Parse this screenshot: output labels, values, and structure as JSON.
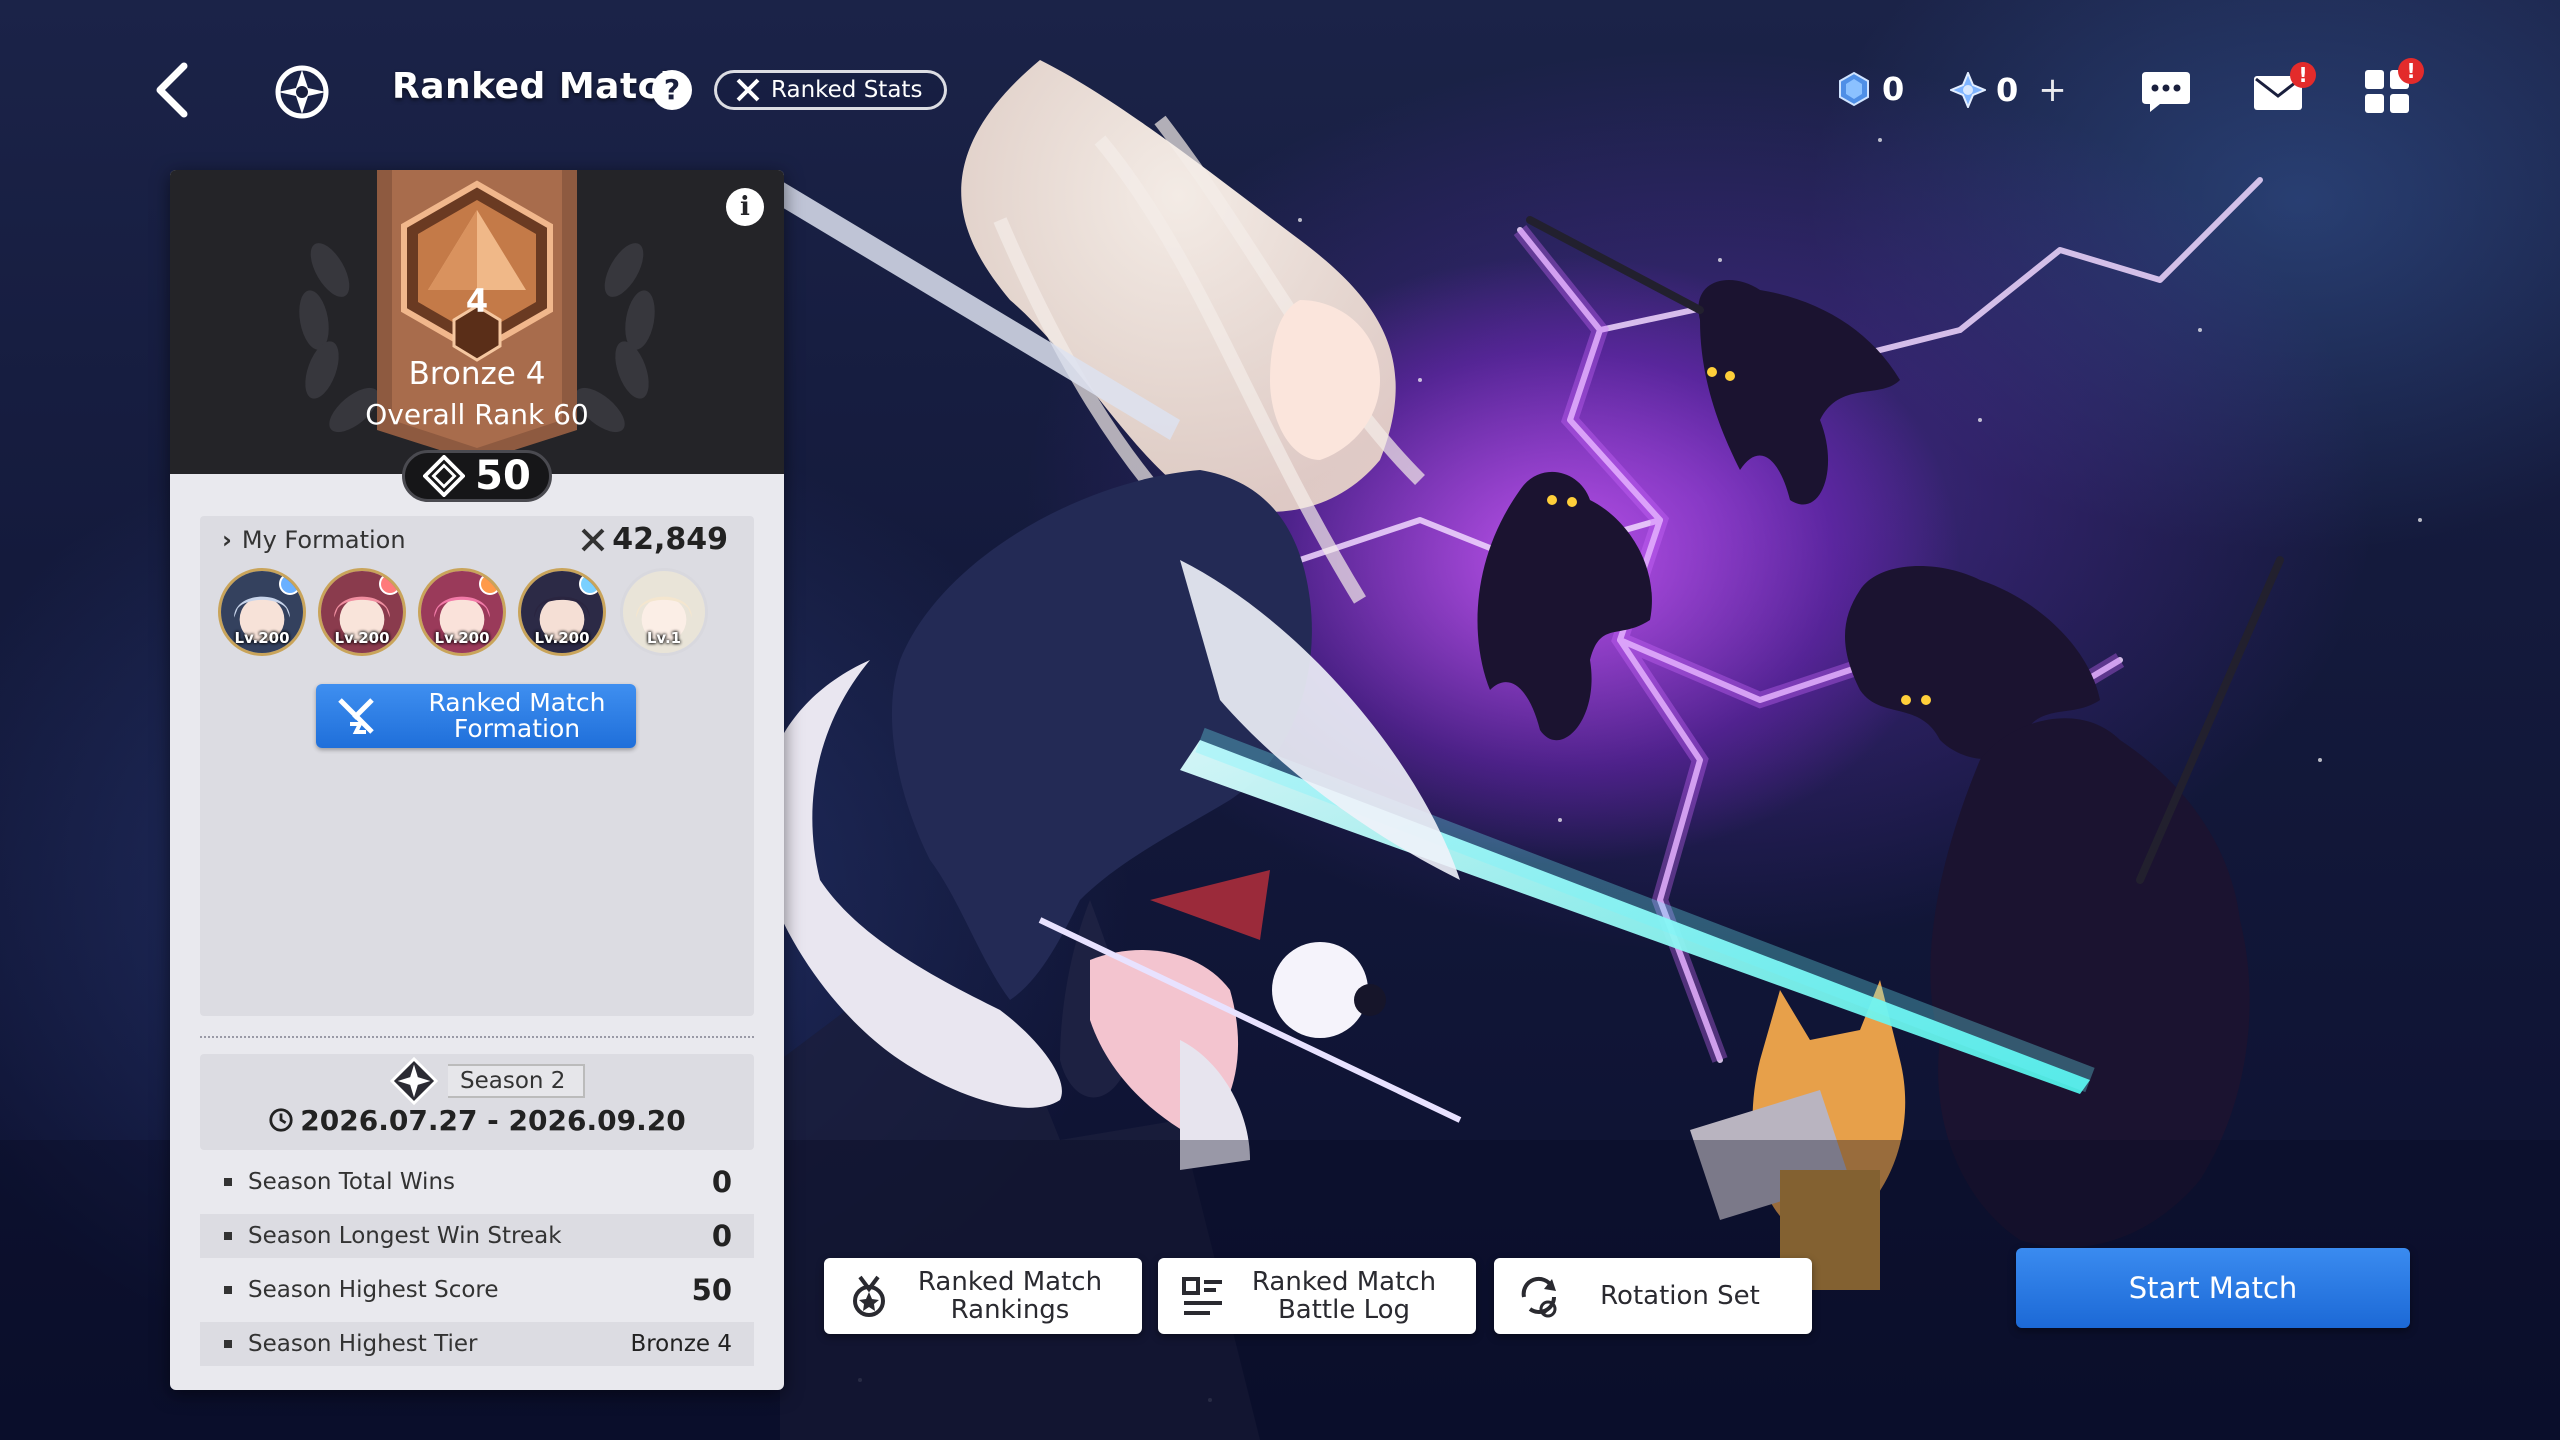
{
  "header": {
    "title": "Ranked Match",
    "help_label": "?",
    "stats_label": "Ranked Stats",
    "currency_1": "0",
    "currency_2": "0",
    "currency_2_add": "+",
    "alert_mail": "!",
    "alert_menu": "!"
  },
  "rank_card": {
    "info_label": "i",
    "tier_number": "4",
    "tier_name": "Bronze 4",
    "overall_rank": "Overall Rank 60",
    "score": "50"
  },
  "formation": {
    "label": "My Formation",
    "power": "42,849",
    "members": [
      {
        "level": "Lv.200",
        "hair": "#c8d4ea",
        "element": "#6ab0ff"
      },
      {
        "level": "Lv.200",
        "hair": "#f08ea0",
        "element": "#ff7a7a"
      },
      {
        "level": "Lv.200",
        "hair": "#f27aa8",
        "element": "#ff9a4a"
      },
      {
        "level": "Lv.200",
        "hair": "#2a2540",
        "element": "#7ad0ff"
      },
      {
        "level": "Lv.1",
        "hair": "#f4e6cf",
        "element": ""
      }
    ],
    "button_line1": "Ranked Match",
    "button_line2": "Formation"
  },
  "season": {
    "tag": "Season 2",
    "dates": "2026.07.27 - 2026.09.20",
    "stats": [
      {
        "name": "Season Total Wins",
        "value": "0"
      },
      {
        "name": "Season Longest Win Streak",
        "value": "0"
      },
      {
        "name": "Season Highest Score",
        "value": "50"
      },
      {
        "name": "Season Highest Tier",
        "value": "Bronze 4"
      }
    ]
  },
  "actions": {
    "rankings_line1": "Ranked Match",
    "rankings_line2": "Rankings",
    "log_line1": "Ranked Match",
    "log_line2": "Battle Log",
    "rotation": "Rotation Set",
    "start": "Start Match"
  },
  "colors": {
    "accent_blue": "#1f6fda",
    "bronze": "#b36a3c",
    "alert_red": "#e32b2b"
  },
  "icons": [
    "back-arrow-icon",
    "mode-emblem-icon",
    "help-icon",
    "crossed-swords-icon",
    "gem-icon",
    "crystal-icon",
    "chat-icon",
    "mail-icon",
    "menu-grid-icon",
    "info-icon",
    "diamond-score-icon",
    "rank-medal-icon",
    "rankings-icon",
    "battle-log-icon",
    "rotation-icon",
    "clock-icon",
    "season-emblem-icon"
  ]
}
